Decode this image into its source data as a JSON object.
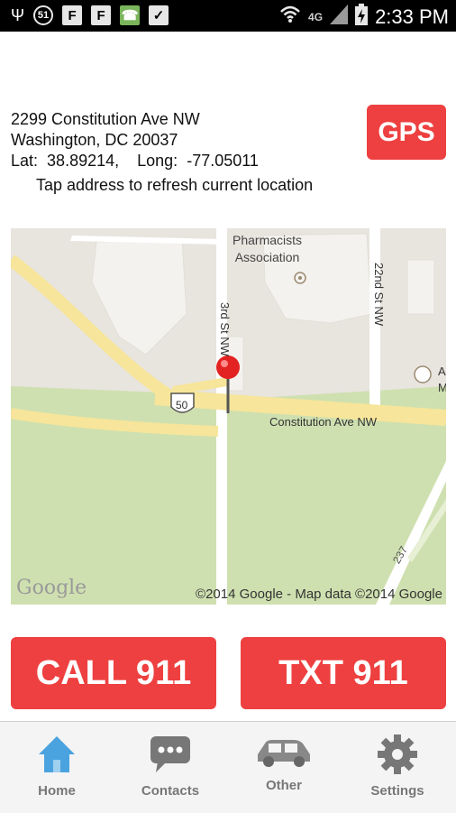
{
  "status_bar": {
    "time": "2:33 PM",
    "network": "4G",
    "notification_badge": "51"
  },
  "location": {
    "address_line1": "2299 Constitution Ave NW",
    "address_line2": "Washington, DC 20037",
    "lat_label": "Lat:",
    "lat_value": "38.89214,",
    "long_label": "Long:",
    "long_value": "-77.05011",
    "hint": "Tap address to refresh current location"
  },
  "gps_button": {
    "label": "GPS"
  },
  "map": {
    "labels": {
      "poi_line1": "Pharmacists",
      "poi_line2": "Association",
      "street_23rd": "3rd St NW",
      "street_22nd": "22nd St NW",
      "constitution": "Constitution Ave NW",
      "route_shield": "50",
      "road_237": "237",
      "edge_letters": "A M"
    },
    "copyright": "©2014 Google - Map data ©2014 Google",
    "logo": "Google"
  },
  "actions": {
    "call_label": "CALL 911",
    "txt_label": "TXT 911"
  },
  "nav": {
    "items": [
      {
        "label": "Home",
        "icon": "home-icon"
      },
      {
        "label": "Contacts",
        "icon": "chat-icon"
      },
      {
        "label": "Other",
        "icon": "car-icon"
      },
      {
        "label": "Settings",
        "icon": "gear-icon"
      }
    ]
  },
  "colors": {
    "accent_red": "#ee4040",
    "home_blue": "#4aa3df",
    "nav_gray": "#777777"
  }
}
